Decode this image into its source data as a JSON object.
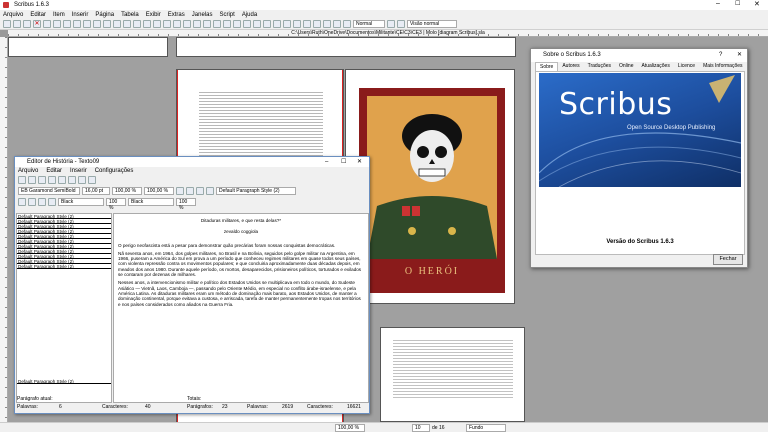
{
  "window": {
    "title": "Scribus 1.6.3"
  },
  "menubar": [
    "Arquivo",
    "Editar",
    "Item",
    "Inserir",
    "Página",
    "Tabela",
    "Exibir",
    "Extras",
    "Janelas",
    "Script",
    "Ajuda"
  ],
  "toolbar": {
    "mode": "Normal",
    "view": "Visão normal"
  },
  "path": "C:\\Users\\Ruth\\OneDrive\\Documentos\\Militante\\CE\\C3\\CE3 | Molo [diagram Scribus].sla",
  "statusbar": {
    "zoom": "100,00 %",
    "page": "10",
    "of": "de 16",
    "layer": "Fundo"
  },
  "poster": {
    "caption": "O   HERÓI"
  },
  "story_editor": {
    "title": "Editor de História - Texto09",
    "menu": [
      "Arquivo",
      "Editar",
      "Inserir",
      "Configurações"
    ],
    "font": "EB Garamond SemiBold",
    "font_size": "16,00 pt",
    "scale_w": "100,00 %",
    "scale_h": "100,00 %",
    "para_style": "Default Paragraph Style (2)",
    "fill_color": "Black",
    "fill_shade": "100 %",
    "stroke_color": "Black",
    "stroke_shade": "100 %",
    "para_items": [
      "Default Paragraph Style (2)",
      "Default Paragraph Style (2)",
      "Default Paragraph Style (2)",
      "Default Paragraph Style (2)",
      "Default Paragraph Style (2)",
      "Default Paragraph Style (2)",
      "Default Paragraph Style (2)",
      "Default Paragraph Style (2)",
      "Default Paragraph Style (2)",
      "Default Paragraph Style (2)",
      "Default Paragraph Style (2)"
    ],
    "para_item_bottom": "Default Paragraph Style (2)",
    "text": {
      "heading": "Ditaduras militares, e que resta delas?*",
      "author": "zevaldo coggiola",
      "p1": "O perigo neofascista está a pesar para demonstrar quão precárias foram nossas conquistas democráticas.",
      "p2": "Nã seventa anos, em 1964, dos golpes militares, no Brasil e na Bolívia, seguidos pelo golpe militar na Argentina, em 1966, puseram a América do Sul em prova a um período que conheceu regimes militares em quase todos seus países, com violenta repressão contra os movimentos populares; e que concluiria aproximadamente duas décadas depois, em meados dos anos 1980. Durante aquele período, os mortos, desaparecidos, prisioneiros políticos, torturados e exilados se contaram por dezenas de milhares.",
      "p3": "Nesses anos, a intervencionismo militar e político dos Estados Unidos se multiplicava em todo o mundo, do Sudeste Asiático — Vietnã, Laos, Camboja —, passando pelo Oriente Médio, em especial no conflito árabe-israelense, e pela América Latina. As ditaduras militares eram um método de dominação mais barato, aos Estados Unidos, de manter a dominação continental, porque evitava a custosa, e arriscada, tarefa de manter permanentemente tropas nos territórios e nos países considerados como aliados na Guerra Fria."
    },
    "footer": {
      "para_label": "Parágrafo atual:",
      "words_label": "Palavras:",
      "words": "6",
      "chars_label": "Caracteres:",
      "chars": "40",
      "totals_label": "Totais:",
      "tot_para_label": "Parágrafos:",
      "tot_para": "23",
      "tot_words_label": "Palavras:",
      "tot_words": "2619",
      "tot_chars_label": "Caracteres:",
      "tot_chars": "16621"
    }
  },
  "about": {
    "title": "Sobre o Scribus 1.6.3",
    "help": "?",
    "tabs": [
      "Sobre",
      "Autores",
      "Traduções",
      "Online",
      "Atualizações",
      "Licence",
      "Mais Informações"
    ],
    "logo": "Scribus",
    "tagline": "Open Source Desktop Publishing",
    "version": "Versão do Scribus 1.6.3",
    "close": "Fechar"
  }
}
